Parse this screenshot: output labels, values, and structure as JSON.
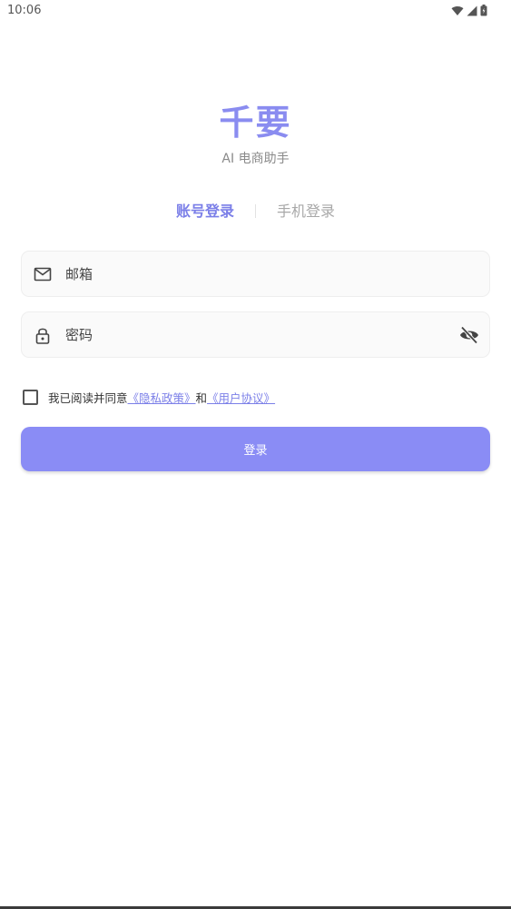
{
  "status_bar": {
    "time": "10:06",
    "icons": [
      "wifi-icon",
      "signal-icon",
      "battery-icon"
    ]
  },
  "brand": {
    "title": "千要",
    "subtitle": "AI 电商助手"
  },
  "tabs": [
    {
      "label": "账号登录",
      "active": true
    },
    {
      "label": "手机登录",
      "active": false
    }
  ],
  "form": {
    "email": {
      "placeholder": "邮箱",
      "value": "",
      "icon": "mail-icon"
    },
    "password": {
      "placeholder": "密码",
      "value": "",
      "icon": "lock-icon",
      "toggle_icon": "eye-off-icon"
    }
  },
  "agreement": {
    "prefix": "我已阅读并同意",
    "privacy_link": "《隐私政策》",
    "conjunction": "和",
    "terms_link": "《用户协议》",
    "checked": false
  },
  "login_button": {
    "label": "登录"
  },
  "colors": {
    "accent": "#7B7FE8",
    "button": "#8A8CF5",
    "brand": "#8A8CF0"
  }
}
